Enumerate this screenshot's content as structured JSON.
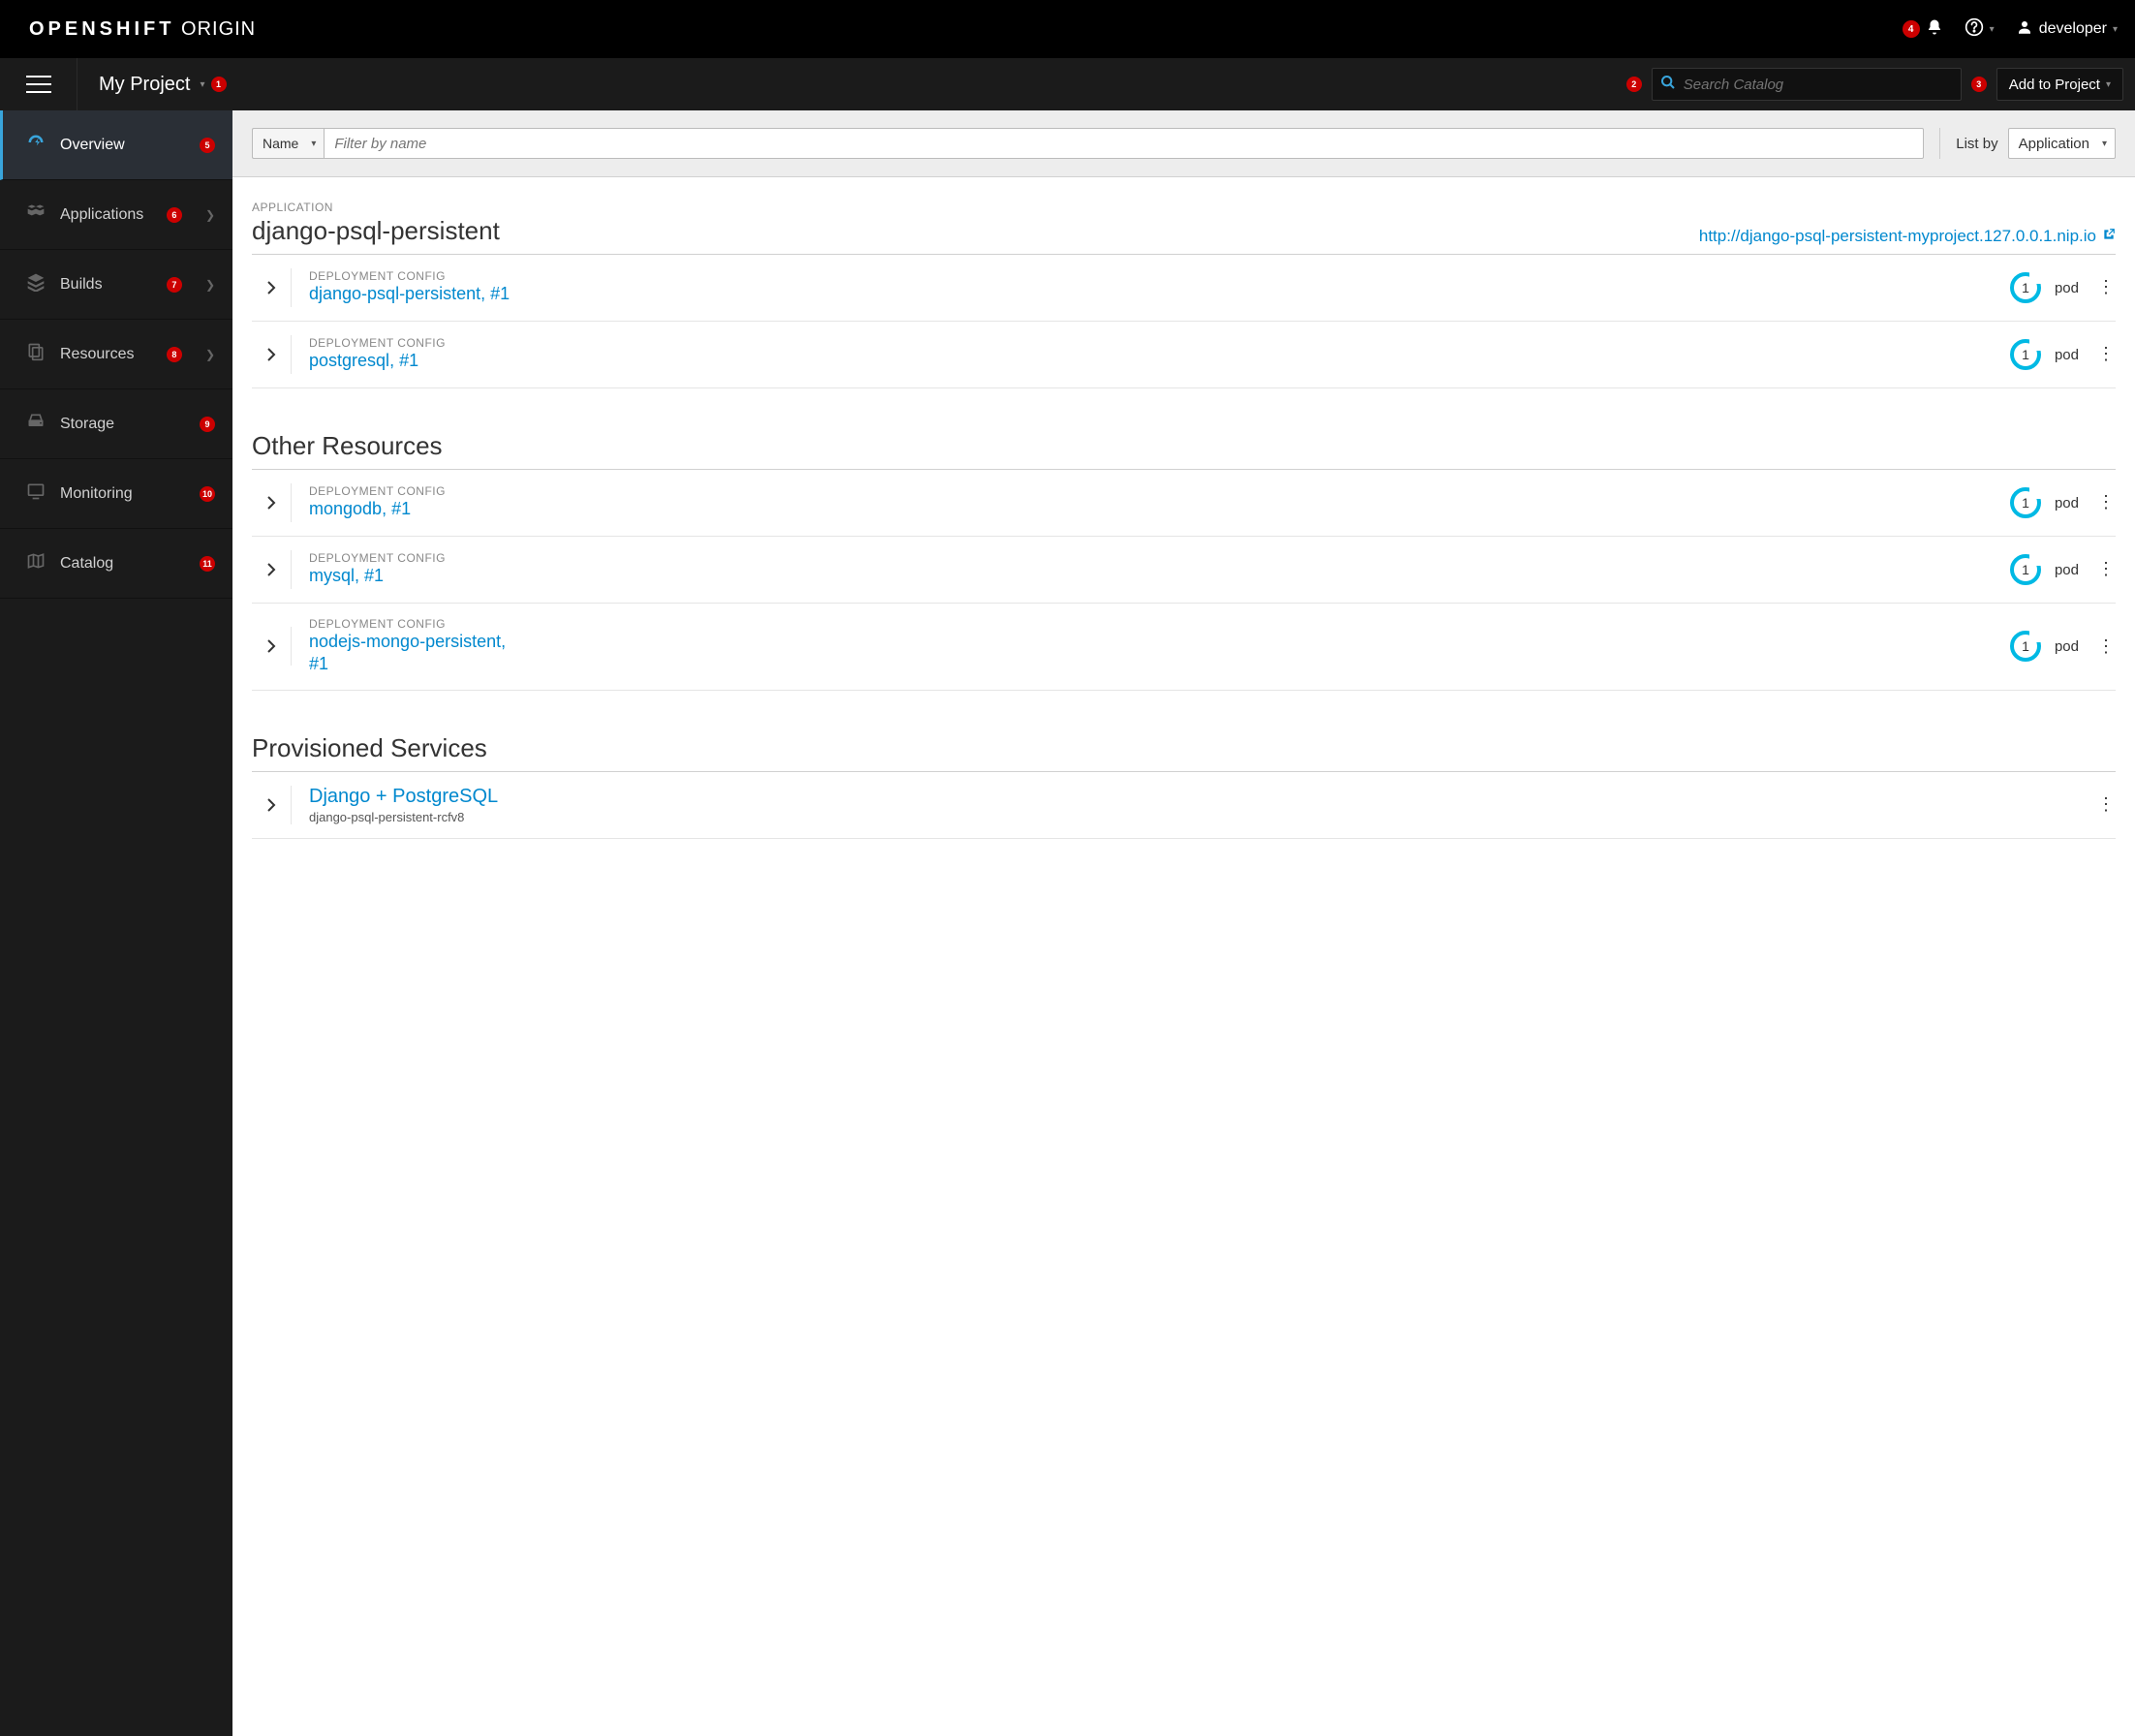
{
  "brand": {
    "bold": "OPENSHIFT",
    "thin": "ORIGIN"
  },
  "topbar": {
    "notif_badge": "4",
    "user": "developer"
  },
  "subbar": {
    "project": "My Project",
    "project_badge": "1",
    "search_badge": "2",
    "search_placeholder": "Search Catalog",
    "add_badge": "3",
    "add_label": "Add to Project"
  },
  "sidebar": {
    "items": [
      {
        "label": "Overview",
        "badge": "5",
        "chevron": false,
        "icon": "dashboard"
      },
      {
        "label": "Applications",
        "badge": "6",
        "chevron": true,
        "icon": "cubes"
      },
      {
        "label": "Builds",
        "badge": "7",
        "chevron": true,
        "icon": "stack"
      },
      {
        "label": "Resources",
        "badge": "8",
        "chevron": true,
        "icon": "files"
      },
      {
        "label": "Storage",
        "badge": "9",
        "chevron": false,
        "icon": "hdd"
      },
      {
        "label": "Monitoring",
        "badge": "10",
        "chevron": false,
        "icon": "monitor"
      },
      {
        "label": "Catalog",
        "badge": "11",
        "chevron": false,
        "icon": "map"
      }
    ]
  },
  "toolbar": {
    "filter_by": "Name",
    "filter_placeholder": "Filter by name",
    "list_by_label": "List by",
    "list_by_value": "Application"
  },
  "app_section": {
    "kind": "APPLICATION",
    "name": "django-psql-persistent",
    "route": "http://django-psql-persistent-myproject.127.0.0.1.nip.io",
    "rows": [
      {
        "kind": "DEPLOYMENT CONFIG",
        "name": "django-psql-persistent",
        "rev": "#1",
        "pods": "1",
        "pod_label": "pod"
      },
      {
        "kind": "DEPLOYMENT CONFIG",
        "name": "postgresql",
        "rev": "#1",
        "pods": "1",
        "pod_label": "pod"
      }
    ]
  },
  "other_section": {
    "title": "Other Resources",
    "rows": [
      {
        "kind": "DEPLOYMENT CONFIG",
        "name": "mongodb",
        "rev": "#1",
        "pods": "1",
        "pod_label": "pod"
      },
      {
        "kind": "DEPLOYMENT CONFIG",
        "name": "mysql",
        "rev": "#1",
        "pods": "1",
        "pod_label": "pod"
      },
      {
        "kind": "DEPLOYMENT CONFIG",
        "name": "nodejs-mongo-persistent",
        "rev": "#1",
        "pods": "1",
        "pod_label": "pod"
      }
    ]
  },
  "services_section": {
    "title": "Provisioned Services",
    "rows": [
      {
        "name": "Django + PostgreSQL",
        "sub": "django-psql-persistent-rcfv8"
      }
    ]
  }
}
